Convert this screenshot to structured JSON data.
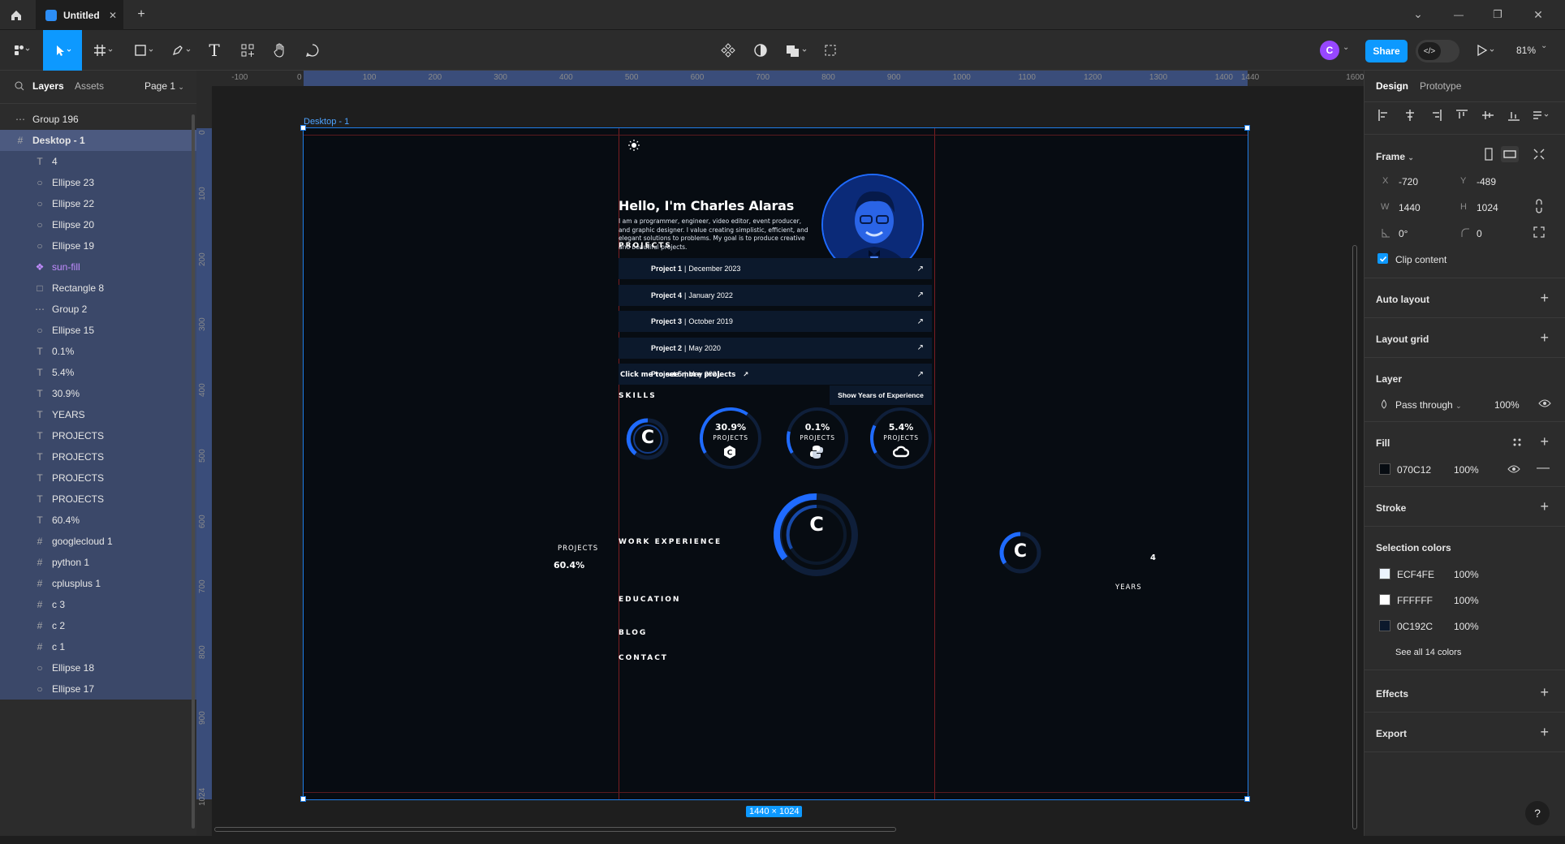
{
  "window": {
    "tab_title": "Untitled",
    "add_tab": "+",
    "controls": {
      "chevron": "⌄",
      "minimize": "—",
      "restore": "❐",
      "close": "✕"
    }
  },
  "toolbar": {
    "share_label": "Share",
    "zoom_label": "81%",
    "avatar_letter": "C",
    "text_tool": "T",
    "dev_mode": "</>"
  },
  "left_panel": {
    "tabs": {
      "layers": "Layers",
      "assets": "Assets"
    },
    "page": "Page 1",
    "layers": [
      {
        "name": "Group 196",
        "icon": "group-icon"
      },
      {
        "name": "Desktop - 1",
        "icon": "frame-icon",
        "selected": true
      },
      {
        "name": "4",
        "icon": "text-icon"
      },
      {
        "name": "Ellipse 23",
        "icon": "ellipse-icon"
      },
      {
        "name": "Ellipse 22",
        "icon": "ellipse-icon"
      },
      {
        "name": "Ellipse 20",
        "icon": "ellipse-icon"
      },
      {
        "name": "Ellipse 19",
        "icon": "ellipse-icon"
      },
      {
        "name": "sun-fill",
        "icon": "component-icon"
      },
      {
        "name": "Rectangle 8",
        "icon": "rectangle-icon"
      },
      {
        "name": "Group 2",
        "icon": "group-icon"
      },
      {
        "name": "Ellipse 15",
        "icon": "ellipse-icon"
      },
      {
        "name": "0.1%",
        "icon": "text-icon"
      },
      {
        "name": "5.4%",
        "icon": "text-icon"
      },
      {
        "name": "30.9%",
        "icon": "text-icon"
      },
      {
        "name": "YEARS",
        "icon": "text-icon"
      },
      {
        "name": "PROJECTS",
        "icon": "text-icon"
      },
      {
        "name": "PROJECTS",
        "icon": "text-icon"
      },
      {
        "name": "PROJECTS",
        "icon": "text-icon"
      },
      {
        "name": "PROJECTS",
        "icon": "text-icon"
      },
      {
        "name": "60.4%",
        "icon": "text-icon"
      },
      {
        "name": "googlecloud 1",
        "icon": "frame-icon"
      },
      {
        "name": "python 1",
        "icon": "frame-icon"
      },
      {
        "name": "cplusplus 1",
        "icon": "frame-icon"
      },
      {
        "name": "c 3",
        "icon": "frame-icon"
      },
      {
        "name": "c 2",
        "icon": "frame-icon"
      },
      {
        "name": "c 1",
        "icon": "frame-icon"
      },
      {
        "name": "Ellipse 18",
        "icon": "ellipse-icon"
      },
      {
        "name": "Ellipse 17",
        "icon": "ellipse-icon"
      }
    ]
  },
  "rulers": {
    "top": [
      "-100",
      "0",
      "100",
      "200",
      "300",
      "400",
      "500",
      "600",
      "700",
      "800",
      "900",
      "1000",
      "1100",
      "1200",
      "1300",
      "1400",
      "1440",
      "1600"
    ],
    "left": [
      "0",
      "100",
      "200",
      "300",
      "400",
      "500",
      "600",
      "700",
      "800",
      "900",
      "1024"
    ]
  },
  "canvas": {
    "frame_label": "Desktop - 1",
    "size_badge": "1440 × 1024"
  },
  "design": {
    "greeting": "Hello, I'm Charles Alaras",
    "bio": "I am a programmer, engineer, video editor, event producer, and graphic designer. I value creating simplistic, efficient, and elegant solutions to problems. My goal is to produce creative and beautiful projects.",
    "projects_heading": "PROJECTS",
    "projects": [
      {
        "name": "Project 1",
        "date": "December 2023"
      },
      {
        "name": "Project 4",
        "date": "January 2022"
      },
      {
        "name": "Project 3",
        "date": "October 2019"
      },
      {
        "name": "Project 2",
        "date": "May 2020"
      },
      {
        "name": "Project 5",
        "date": "May 2021"
      }
    ],
    "more_projects": "Click me to see more projects",
    "skills_heading": "SKILLS",
    "experience_button": "Show Years of Experience",
    "skills": [
      {
        "percent": "30.9%",
        "label": "PROJECTS",
        "icon": "cplusplus-icon",
        "value": 0.309
      },
      {
        "percent": "0.1%",
        "label": "PROJECTS",
        "icon": "python-icon",
        "value": 0.001
      },
      {
        "percent": "5.4%",
        "label": "PROJECTS",
        "icon": "googlecloud-icon",
        "value": 0.054
      }
    ],
    "outside_left": {
      "label": "PROJECTS",
      "percent": "60.4%"
    },
    "outside_right": {
      "number": "4",
      "label": "YEARS"
    },
    "c_letter": "C",
    "nav": [
      "WORK EXPERIENCE",
      "EDUCATION",
      "BLOG",
      "CONTACT"
    ],
    "accent": "#1f6bff"
  },
  "right_panel": {
    "tabs": {
      "design": "Design",
      "prototype": "Prototype"
    },
    "frame_label": "Frame",
    "x_label": "X",
    "x": "-720",
    "y_label": "Y",
    "y": "-489",
    "w_label": "W",
    "w": "1440",
    "h_label": "H",
    "h": "1024",
    "rotation": "0°",
    "radius": "0",
    "clip_content": "Clip content",
    "auto_layout": "Auto layout",
    "layout_grid": "Layout grid",
    "layer_heading": "Layer",
    "blend_mode": "Pass through",
    "layer_opacity": "100%",
    "fill_heading": "Fill",
    "fill_hex": "070C12",
    "fill_opacity": "100%",
    "stroke_heading": "Stroke",
    "selection_colors_heading": "Selection colors",
    "selection_colors": [
      {
        "hex": "ECF4FE",
        "opacity": "100%",
        "swatch": "#ECF4FE"
      },
      {
        "hex": "FFFFFF",
        "opacity": "100%",
        "swatch": "#FFFFFF"
      },
      {
        "hex": "0C192C",
        "opacity": "100%",
        "swatch": "#0C192C"
      }
    ],
    "see_all_colors": "See all 14 colors",
    "effects": "Effects",
    "export": "Export",
    "help": "?"
  }
}
